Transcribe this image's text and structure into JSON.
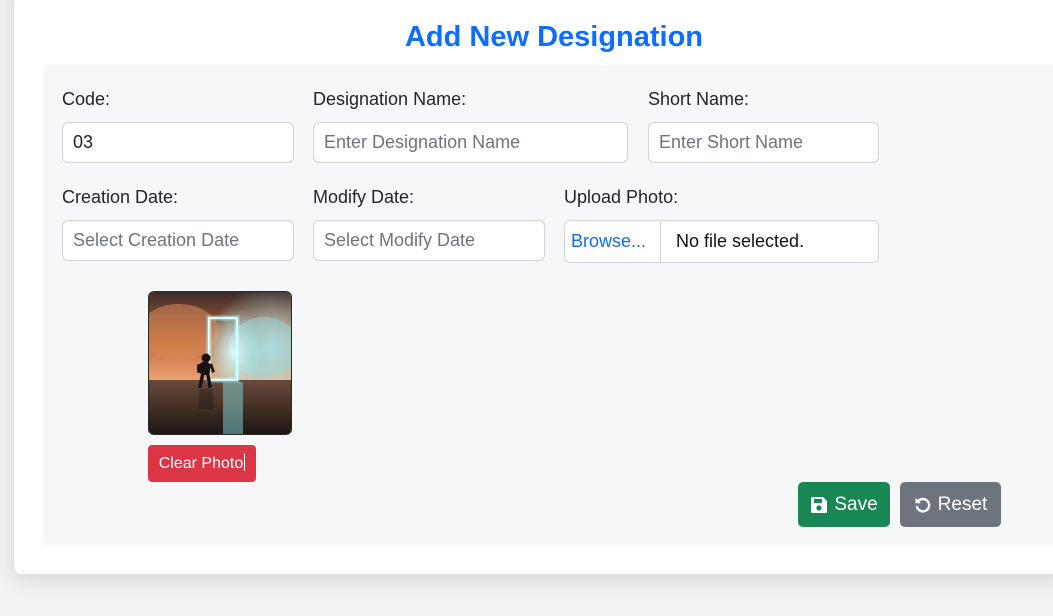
{
  "form": {
    "title": "Add New Designation",
    "fields": {
      "code": {
        "label": "Code:",
        "value": "03"
      },
      "designation_name": {
        "label": "Designation Name:",
        "placeholder": "Enter Designation Name"
      },
      "short_name": {
        "label": "Short Name:",
        "placeholder": "Enter Short Name"
      },
      "creation_date": {
        "label": "Creation Date:",
        "placeholder": "Select Creation Date"
      },
      "modify_date": {
        "label": "Modify Date:",
        "placeholder": "Select Modify Date"
      },
      "upload_photo": {
        "label": "Upload Photo:",
        "browse_label": "Browse...",
        "file_status": "No file selected."
      }
    },
    "photo": {
      "clear_label": "Clear Photo"
    },
    "actions": {
      "save_label": "Save",
      "reset_label": "Reset"
    }
  },
  "colors": {
    "title": "#0d6efd",
    "save": "#198754",
    "reset": "#6c757d",
    "clear": "#dc3545",
    "panel": "#f6f7f9"
  },
  "icons": {
    "save": "floppy-disk-icon",
    "reset": "counterclockwise-arrow-icon"
  }
}
